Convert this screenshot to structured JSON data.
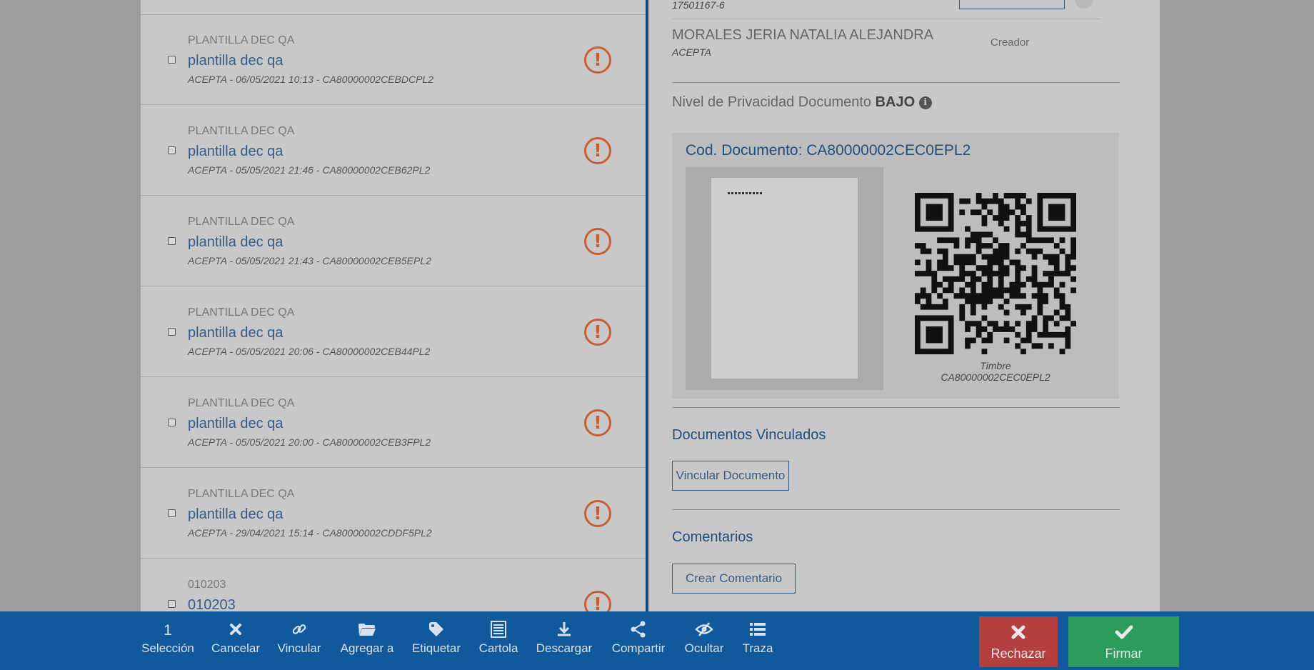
{
  "documents": [
    {
      "type": "PLANTILLA DEC QA",
      "name": "plantilla dec qa",
      "meta": "ACEPTA - 06/05/2021 10:13 - CA80000002CEBDCPL2"
    },
    {
      "type": "PLANTILLA DEC QA",
      "name": "plantilla dec qa",
      "meta": "ACEPTA - 05/05/2021 21:46 - CA80000002CEB62PL2"
    },
    {
      "type": "PLANTILLA DEC QA",
      "name": "plantilla dec qa",
      "meta": "ACEPTA - 05/05/2021 21:43 - CA80000002CEB5EPL2"
    },
    {
      "type": "PLANTILLA DEC QA",
      "name": "plantilla dec qa",
      "meta": "ACEPTA - 05/05/2021 20:06 - CA80000002CEB44PL2"
    },
    {
      "type": "PLANTILLA DEC QA",
      "name": "plantilla dec qa",
      "meta": "ACEPTA - 05/05/2021 20:00 - CA80000002CEB3FPL2"
    },
    {
      "type": "PLANTILLA DEC QA",
      "name": "plantilla dec qa",
      "meta": "ACEPTA - 29/04/2021 15:14 - CA80000002CDDF5PL2"
    },
    {
      "type": "010203",
      "name": "010203",
      "meta": ""
    }
  ],
  "detail": {
    "top_rut": "17501167-6",
    "signer_name": "MORALES JERIA NATALIA ALEJANDRA",
    "signer_org": "ACEPTA",
    "signer_role": "Creador",
    "privacy_label": "Nivel de Privacidad Documento",
    "privacy_value": "BAJO",
    "doc_code_title": "Cod. Documento: CA80000002CEC0EPL2",
    "timbre": "Timbre CA80000002CEC0EPL2",
    "linked_title": "Documentos Vinculados",
    "link_button": "Vincular Documento",
    "comments_title": "Comentarios",
    "comment_button": "Crear Comentario"
  },
  "toolbar": {
    "selection_count": "1",
    "items": [
      {
        "label": "Selección",
        "icon": "count"
      },
      {
        "label": "Cancelar",
        "icon": "times-icon"
      },
      {
        "label": "Vincular",
        "icon": "link-icon"
      },
      {
        "label": "Agregar a",
        "icon": "folder-icon"
      },
      {
        "label": "Etiquetar",
        "icon": "tag-icon"
      },
      {
        "label": "Cartola",
        "icon": "list-document-icon"
      },
      {
        "label": "Descargar",
        "icon": "download-icon"
      },
      {
        "label": "Compartir",
        "icon": "share-icon"
      },
      {
        "label": "Ocultar",
        "icon": "eye-slash-icon"
      },
      {
        "label": "Traza",
        "icon": "list-icon"
      }
    ],
    "reject": "Rechazar",
    "sign": "Firmar"
  },
  "colors": {
    "toolbar_bg": "#10599c",
    "reject_bg": "#b53e3e",
    "sign_bg": "#2b9c59",
    "warning": "#c65d35",
    "link_text": "#335c8a"
  }
}
